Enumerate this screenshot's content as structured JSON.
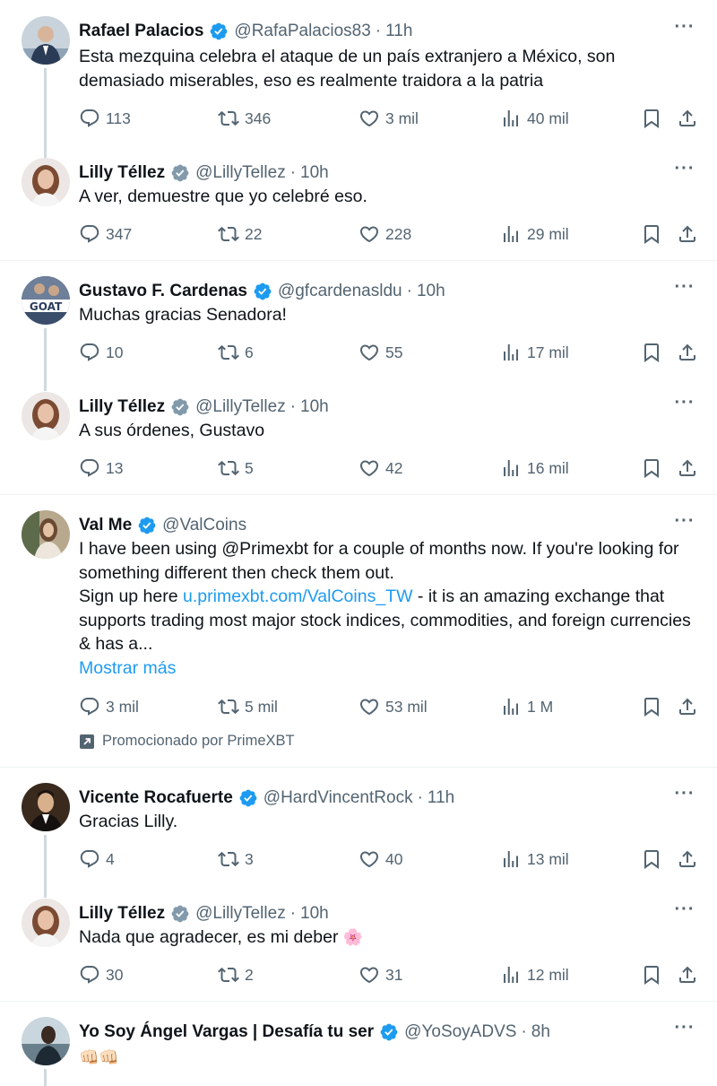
{
  "posts": [
    {
      "name": "Rafael Palacios",
      "handle": "@RafaPalacios83",
      "time": "11h",
      "verified": "blue",
      "text": "Esta mezquina celebra el ataque de un país extranjero a México, son demasiado miserables, eso es realmente traidora a la patria",
      "replies": "113",
      "reposts": "346",
      "likes": "3 mil",
      "views": "40 mil"
    },
    {
      "name": "Lilly Téllez",
      "handle": "@LillyTellez",
      "time": "10h",
      "verified": "gray",
      "text": "A ver, demuestre que yo celebré eso.",
      "replies": "347",
      "reposts": "22",
      "likes": "228",
      "views": "29 mil"
    },
    {
      "name": "Gustavo F. Cardenas",
      "handle": "@gfcardenasldu",
      "time": "10h",
      "verified": "blue",
      "text": "Muchas gracias Senadora!",
      "replies": "10",
      "reposts": "6",
      "likes": "55",
      "views": "17 mil"
    },
    {
      "name": "Lilly Téllez",
      "handle": "@LillyTellez",
      "time": "10h",
      "verified": "gray",
      "text": "A sus órdenes, Gustavo",
      "replies": "13",
      "reposts": "5",
      "likes": "42",
      "views": "16 mil"
    },
    {
      "name": "Val Me",
      "handle": "@ValCoins",
      "time": "",
      "verified": "blue",
      "text_line1": "I have been using @Primexbt for  a couple of months now. If you're looking for something different then check them out.",
      "text_line2_prefix": "Sign up here ",
      "text_link": "u.primexbt.com/ValCoins_TW",
      "text_line2_suffix": " - it is an amazing exchange that supports trading  most major stock indices, commodities, and foreign currencies & has a...",
      "show_more": "Mostrar más",
      "replies": "3 mil",
      "reposts": "5 mil",
      "likes": "53 mil",
      "views": "1 M",
      "promoted": "Promocionado por PrimeXBT"
    },
    {
      "name": "Vicente Rocafuerte",
      "handle": "@HardVincentRock",
      "time": "11h",
      "verified": "blue",
      "text": "Gracias Lilly.",
      "replies": "4",
      "reposts": "3",
      "likes": "40",
      "views": "13 mil"
    },
    {
      "name": "Lilly Téllez",
      "handle": "@LillyTellez",
      "time": "10h",
      "verified": "gray",
      "text": "Nada que agradecer, es mi deber",
      "text_emoji": "🌸",
      "replies": "30",
      "reposts": "2",
      "likes": "31",
      "views": "12 mil"
    },
    {
      "name": "Yo Soy Ángel Vargas | Desafía tu ser",
      "handle": "@YoSoyADVS",
      "time": "8h",
      "verified": "blue",
      "text": "👊🏻👊🏻"
    }
  ],
  "separator": "·",
  "more_glyph": "···",
  "colors": {
    "accent": "#1d9bf0",
    "muted": "#536471",
    "text": "#0f1419",
    "gray_badge": "#829aab"
  }
}
